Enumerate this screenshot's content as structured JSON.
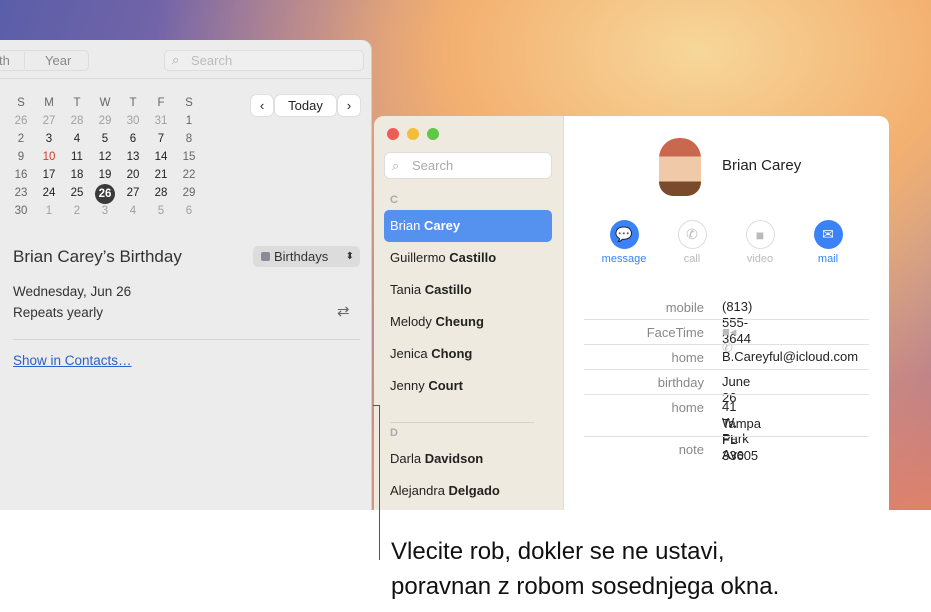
{
  "calendar": {
    "view_tabs": [
      "th",
      "Year"
    ],
    "search_placeholder": "Search",
    "weekdays": [
      "S",
      "M",
      "T",
      "W",
      "T",
      "F",
      "S"
    ],
    "weeks": [
      [
        "26",
        "27",
        "28",
        "29",
        "30",
        "31",
        "1"
      ],
      [
        "2",
        "3",
        "4",
        "5",
        "6",
        "7",
        "8"
      ],
      [
        "9",
        "10",
        "11",
        "12",
        "13",
        "14",
        "15"
      ],
      [
        "16",
        "17",
        "18",
        "19",
        "20",
        "21",
        "22"
      ],
      [
        "23",
        "24",
        "25",
        "26",
        "27",
        "28",
        "29"
      ],
      [
        "30",
        "1",
        "2",
        "3",
        "4",
        "5",
        "6"
      ]
    ],
    "today_label": "Today",
    "selected_day": "26",
    "today_day": "10",
    "event": {
      "title": "Brian Carey’s Birthday",
      "calendar": "Birthdays",
      "date": "Wednesday, Jun 26",
      "repeat": "Repeats yearly",
      "link": "Show in Contacts…"
    }
  },
  "contacts": {
    "search_placeholder": "Search",
    "sections": [
      {
        "letter": "C",
        "items": [
          "Brian Carey",
          "Guillermo Castillo",
          "Tania Castillo",
          "Melody Cheung",
          "Jenica Chong",
          "Jenny Court"
        ]
      },
      {
        "letter": "D",
        "items": [
          "Darla Davidson",
          "Alejandra Delgado"
        ]
      }
    ],
    "selected": "Brian Carey",
    "card": {
      "name": "Brian Carey",
      "actions": [
        "message",
        "call",
        "video",
        "mail"
      ],
      "fields": [
        {
          "label": "mobile",
          "value": "(813) 555-3644"
        },
        {
          "label": "FaceTime",
          "value": ""
        },
        {
          "label": "home",
          "value": "B.Careyful@icloud.com"
        },
        {
          "label": "birthday",
          "value": "June 26"
        },
        {
          "label": "home",
          "value": "41 W. Park Ave",
          "value2": "Tampa FL 33605"
        },
        {
          "label": "note",
          "value": ""
        }
      ]
    }
  },
  "caption": {
    "line1": "Vlecite rob, dokler se ne ustavi,",
    "line2": "poravnan z robom sosednjega okna."
  },
  "colors": {
    "accent": "#3b82f6",
    "selected_row": "#5592f0",
    "today_red": "#d53a2a"
  }
}
